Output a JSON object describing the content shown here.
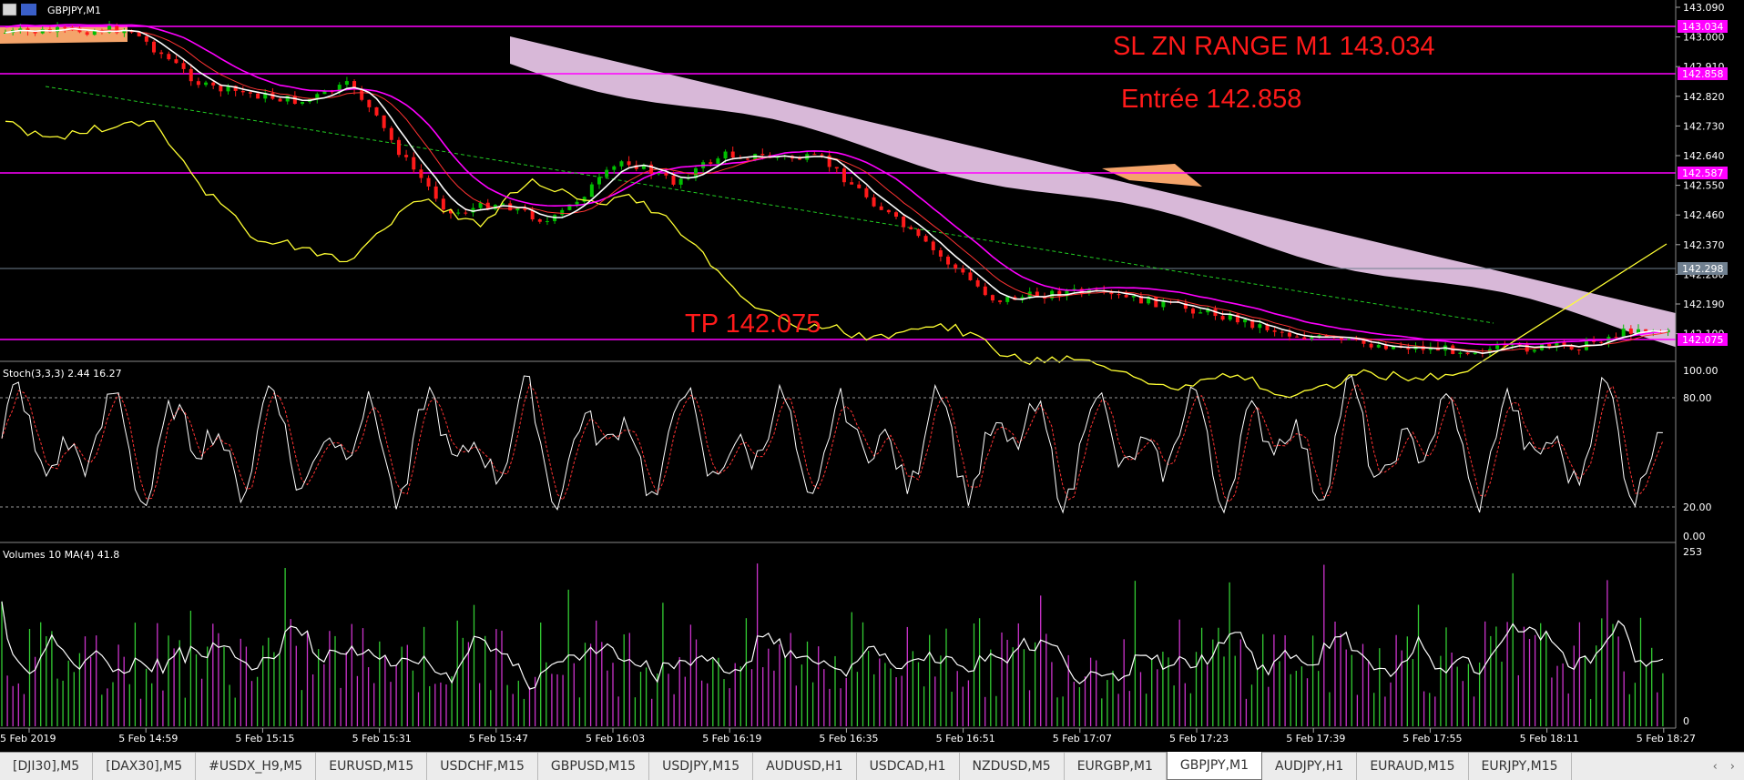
{
  "window": {
    "symbol_title": "GBPJPY,M1"
  },
  "annotations": {
    "sl_text": "SL ZN RANGE M1 143.034",
    "entry_text": "Entrée 142.858",
    "tp_text": "TP 142.075"
  },
  "price_axis": {
    "ticks": [
      "143.090",
      "143.000",
      "142.910",
      "142.820",
      "142.730",
      "142.640",
      "142.550",
      "142.460",
      "142.370",
      "142.280",
      "142.190",
      "142.100"
    ],
    "level_tags": [
      {
        "value": "143.034",
        "color": "#ff00ff"
      },
      {
        "value": "142.858",
        "color": "#ff00ff"
      },
      {
        "value": "142.587",
        "color": "#ff00ff"
      },
      {
        "value": "142.298",
        "color": "#708090"
      },
      {
        "value": "142.075",
        "color": "#ff00ff"
      }
    ]
  },
  "stoch_panel": {
    "label": "Stoch(3,3,3) 2.44 16.27",
    "ticks": [
      "100.00",
      "80.00",
      "20.00",
      "0.00"
    ]
  },
  "volume_panel": {
    "label": "Volumes 10 MA(4) 41.8",
    "ticks": [
      "253",
      "0"
    ]
  },
  "time_axis": [
    "5 Feb 2019",
    "5 Feb 14:59",
    "5 Feb 15:15",
    "5 Feb 15:31",
    "5 Feb 15:47",
    "5 Feb 16:03",
    "5 Feb 16:19",
    "5 Feb 16:35",
    "5 Feb 16:51",
    "5 Feb 17:07",
    "5 Feb 17:23",
    "5 Feb 17:39",
    "5 Feb 17:55",
    "5 Feb 18:11",
    "5 Feb 18:27"
  ],
  "tabs": [
    {
      "label": "[DJI30],M5",
      "active": false
    },
    {
      "label": "[DAX30],M5",
      "active": false
    },
    {
      "label": "#USDX_H9,M5",
      "active": false
    },
    {
      "label": "EURUSD,M15",
      "active": false
    },
    {
      "label": "USDCHF,M15",
      "active": false
    },
    {
      "label": "GBPUSD,M15",
      "active": false
    },
    {
      "label": "USDJPY,M15",
      "active": false
    },
    {
      "label": "AUDUSD,H1",
      "active": false
    },
    {
      "label": "USDCAD,H1",
      "active": false
    },
    {
      "label": "NZDUSD,M5",
      "active": false
    },
    {
      "label": "EURGBP,M1",
      "active": false
    },
    {
      "label": "GBPJPY,M1",
      "active": true
    },
    {
      "label": "AUDJPY,H1",
      "active": false
    },
    {
      "label": "EURAUD,M15",
      "active": false
    },
    {
      "label": "EURJPY,M15",
      "active": false
    }
  ],
  "tab_nav": {
    "left": "‹",
    "right": "›"
  },
  "colors": {
    "background": "#000000",
    "bull_candle": "#00c000",
    "bear_candle": "#ff1a1a",
    "level_line": "#ff00ff",
    "cloud": "#d8b8d8",
    "cloud_orange": "#f4a46a",
    "tenkan": "#ffffff",
    "kijun": "#ff00ff",
    "chikou": "#ffff33",
    "annotation": "#ff1a1a"
  }
}
